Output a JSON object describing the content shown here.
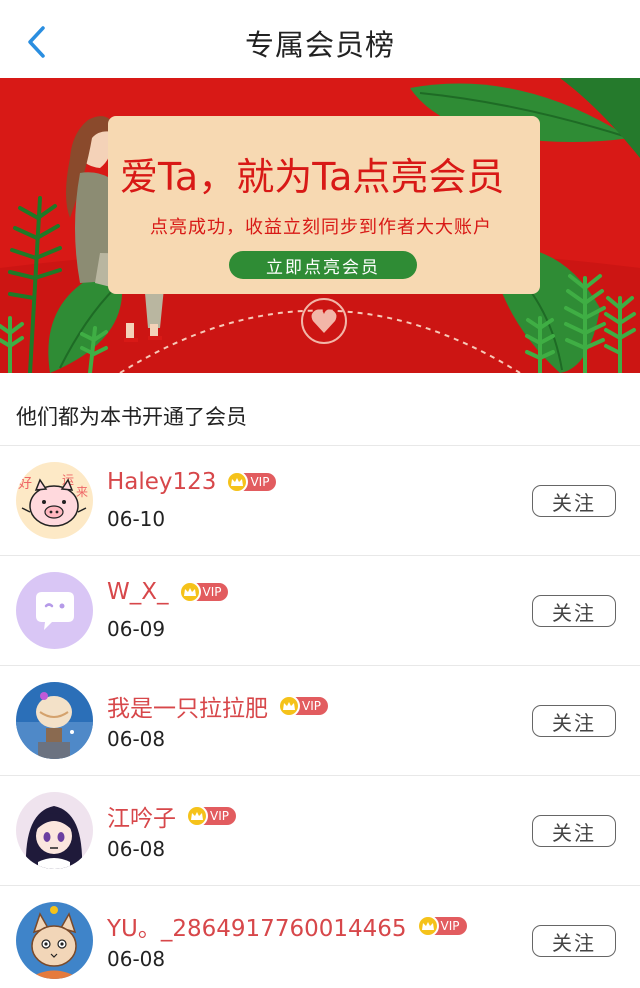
{
  "header": {
    "title": "专属会员榜",
    "back_icon": "chevron-left-icon",
    "accent": "#2a8ee0"
  },
  "banner": {
    "headline": "爱Ta，就为Ta点亮会员",
    "subtitle": "点亮成功，收益立刻同步到作者大大账户",
    "button_label": "立即点亮会员",
    "bg_color": "#d81916",
    "card_color": "#f7d9b2",
    "button_color": "#2f8c35"
  },
  "section": {
    "title": "他们都为本书开通了会员"
  },
  "vip_badge_label": "VIP",
  "follow_label": "关注",
  "members": [
    {
      "name": "Haley123",
      "date": "06-10",
      "avatar": "pig-avatar"
    },
    {
      "name": "W_X_",
      "date": "06-09",
      "avatar": "speech-bubble-avatar"
    },
    {
      "name": "我是一只拉拉肥",
      "date": "06-08",
      "avatar": "balloon-avatar"
    },
    {
      "name": "江吟子",
      "date": "06-08",
      "avatar": "anime-girl-avatar"
    },
    {
      "name": "YU。_2864917760014465",
      "date": "06-08",
      "avatar": "cat-avatar"
    }
  ]
}
